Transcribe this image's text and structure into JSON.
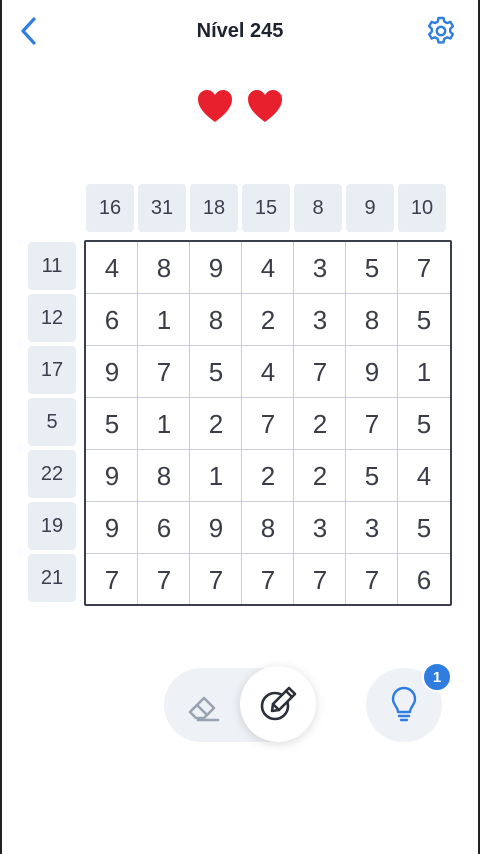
{
  "header": {
    "title": "Nível 245",
    "back_icon": "chevron-left-icon",
    "settings_icon": "gear-icon"
  },
  "lives": {
    "count": 2,
    "icon": "heart-icon",
    "color": "#e8202e"
  },
  "puzzle": {
    "column_clues": [
      "16",
      "31",
      "18",
      "15",
      "8",
      "9",
      "10"
    ],
    "row_clues": [
      "11",
      "12",
      "17",
      "5",
      "22",
      "19",
      "21"
    ],
    "cells": [
      [
        "4",
        "8",
        "9",
        "4",
        "3",
        "5",
        "7"
      ],
      [
        "6",
        "1",
        "8",
        "2",
        "3",
        "8",
        "5"
      ],
      [
        "9",
        "7",
        "5",
        "4",
        "7",
        "9",
        "1"
      ],
      [
        "5",
        "1",
        "2",
        "7",
        "2",
        "7",
        "5"
      ],
      [
        "9",
        "8",
        "1",
        "2",
        "2",
        "5",
        "4"
      ],
      [
        "9",
        "6",
        "9",
        "8",
        "3",
        "3",
        "5"
      ],
      [
        "7",
        "7",
        "7",
        "7",
        "7",
        "7",
        "6"
      ]
    ]
  },
  "toolbar": {
    "eraser_icon": "eraser-icon",
    "pencil_icon": "pencil-icon",
    "hint_icon": "lightbulb-icon",
    "hint_count": "1",
    "accent_color": "#2f7de1"
  }
}
